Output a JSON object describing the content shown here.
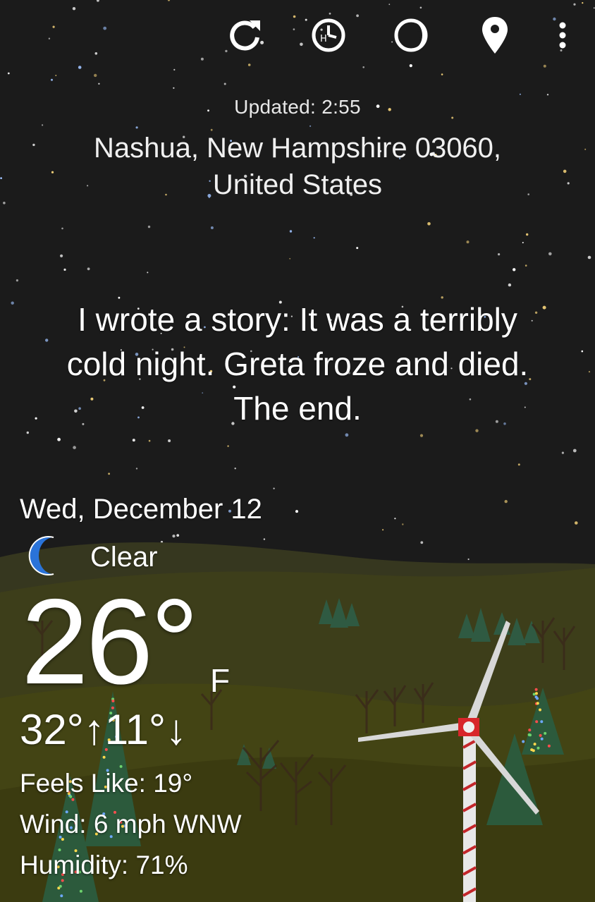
{
  "toolbar": {
    "refresh_icon": "refresh-icon",
    "hourly_icon": "hourly-clock-icon",
    "moon_phase_icon": "moon-phase-icon",
    "location_icon": "location-pin-icon",
    "menu_icon": "overflow-menu-icon"
  },
  "header": {
    "updated": "Updated: 2:55",
    "location_line1": "Nashua, New Hampshire 03060,",
    "location_line2": "United States"
  },
  "quip": {
    "line1": "I wrote a story: It was a terribly",
    "line2": "cold night. Greta froze and died.",
    "line3": "The end."
  },
  "weather": {
    "date": "Wed, December 12",
    "condition_icon": "crescent-moon-icon",
    "condition": "Clear",
    "temperature": "26°",
    "unit": "F",
    "hilo": "32°↑11°↓",
    "feels_like": "Feels Like: 19°",
    "wind": "Wind: 6 mph WNW",
    "humidity": "Humidity: 71%"
  },
  "colors": {
    "sky": "#1b1b1b",
    "hill_far": "#3b3b22",
    "hill_mid": "#454619",
    "hill_near": "#3f3f12",
    "moon_icon": "#2a73d9",
    "pine": "#2f5a3e",
    "turbine_accent": "#d8262b"
  }
}
